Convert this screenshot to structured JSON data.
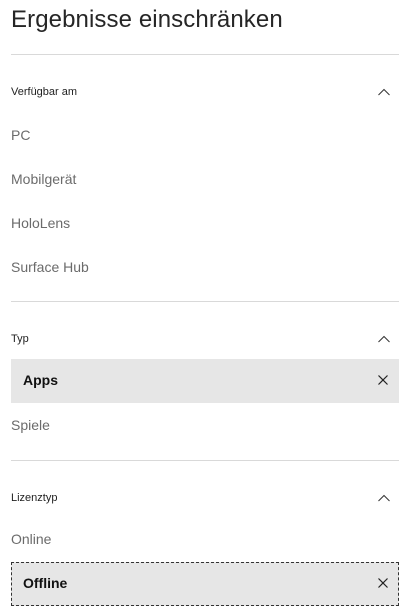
{
  "title": "Ergebnisse einschränken",
  "sections": [
    {
      "label": "Verfügbar am",
      "options": [
        "PC",
        "Mobilgerät",
        "HoloLens",
        "Surface Hub"
      ]
    },
    {
      "label": "Typ",
      "options": [
        "Apps",
        "Spiele"
      ]
    },
    {
      "label": "Lizenztyp",
      "options": [
        "Online",
        "Offline"
      ]
    }
  ]
}
